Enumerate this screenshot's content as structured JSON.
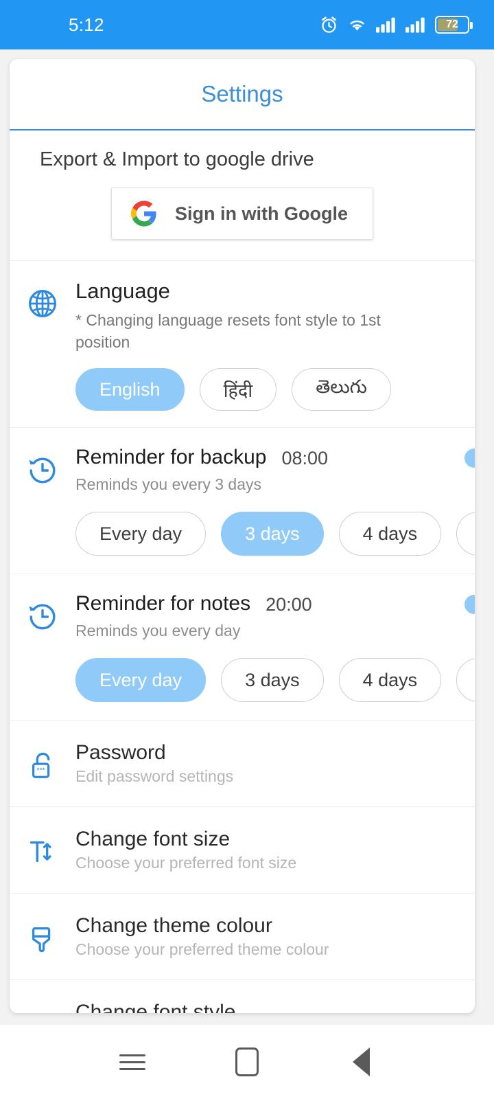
{
  "status_bar": {
    "time": "5:12",
    "battery_level": "72",
    "icons": [
      "alarm-icon",
      "wifi-icon",
      "signal-icon",
      "signal-icon",
      "battery-icon"
    ],
    "background_color": "#2196f3"
  },
  "header": {
    "title": "Settings",
    "accent_color": "#3b8fd6"
  },
  "export": {
    "title": "Export & Import to google drive",
    "google_button_label": "Sign in with Google"
  },
  "language": {
    "title": "Language",
    "note": "* Changing language resets font style to 1st position",
    "options": [
      "English",
      "हिंदी",
      "తెలుగు"
    ],
    "selected": "English"
  },
  "reminder_backup": {
    "title": "Reminder for backup",
    "time": "08:00",
    "subtitle": "Reminds you every 3 days",
    "enabled": true,
    "options": [
      "Every day",
      "3 days",
      "4 days",
      ""
    ],
    "selected": "3 days"
  },
  "reminder_notes": {
    "title": "Reminder for notes",
    "time": "20:00",
    "subtitle": "Reminds you every day",
    "enabled": true,
    "options": [
      "Every day",
      "3 days",
      "4 days",
      ""
    ],
    "selected": "Every day"
  },
  "items": [
    {
      "title": "Password",
      "subtitle": "Edit password settings",
      "icon": "lock-icon"
    },
    {
      "title": "Change font size",
      "subtitle": "Choose your preferred font size",
      "icon": "font-size-icon"
    },
    {
      "title": "Change theme colour",
      "subtitle": "Choose your preferred theme colour",
      "icon": "paintbrush-icon"
    },
    {
      "title": "Change font style",
      "subtitle": "",
      "icon": "font-style-icon"
    }
  ],
  "nav_bar": {
    "recents": "menu-icon",
    "home": "home-icon",
    "back": "back-icon"
  },
  "colors": {
    "accent": "#2196f3",
    "chip_selected": "#90caf9",
    "toggle_thumb": "#1e88e5",
    "icon_blue": "#2e8ae0"
  }
}
